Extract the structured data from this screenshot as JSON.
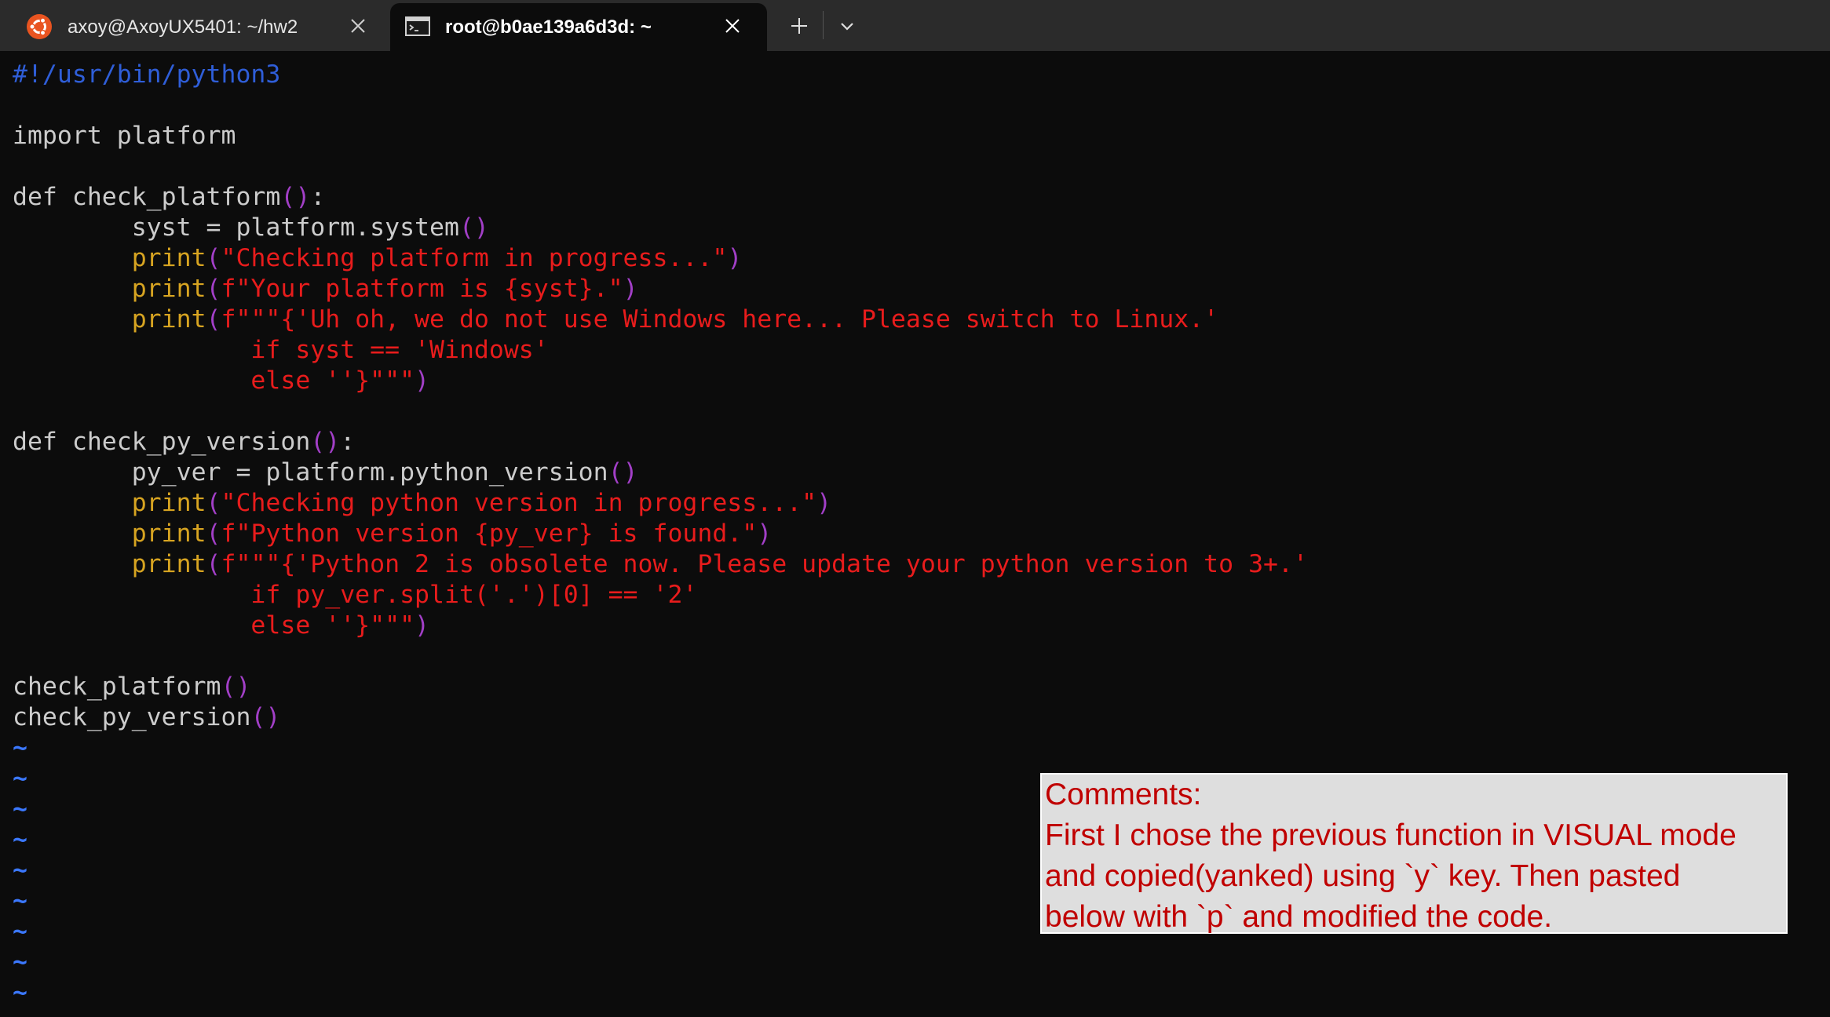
{
  "tabs": [
    {
      "title": "axoy@AxoyUX5401: ~/hw2",
      "icon": "ubuntu-icon",
      "active": false
    },
    {
      "title": "root@b0ae139a6d3d: ~",
      "icon": "terminal-icon",
      "active": true
    }
  ],
  "tabbar": {
    "new_tab_icon": "plus-icon",
    "dropdown_icon": "chevron-down-icon"
  },
  "colors": {
    "background": "#0c0c0c",
    "tabbar": "#2b2b2b",
    "shebang": "#2f5ed8",
    "string": "#e81c1c",
    "builtin": "#d7a421",
    "paren": "#a23fc7",
    "tilde": "#3b78ff",
    "comment_bg": "#dedede",
    "comment_text": "#c00000"
  },
  "code_lines": [
    [
      {
        "t": "#!/usr/bin/python3",
        "c": "shebang"
      }
    ],
    [],
    [
      {
        "t": "import platform",
        "c": "text"
      }
    ],
    [],
    [
      {
        "t": "def check_platform",
        "c": "text"
      },
      {
        "t": "()",
        "c": "paren"
      },
      {
        "t": ":",
        "c": "text"
      }
    ],
    [
      {
        "t": "        syst = platform.system",
        "c": "text"
      },
      {
        "t": "()",
        "c": "paren"
      }
    ],
    [
      {
        "t": "        ",
        "c": "text"
      },
      {
        "t": "print",
        "c": "fn"
      },
      {
        "t": "(",
        "c": "paren"
      },
      {
        "t": "\"Checking platform in progress...\"",
        "c": "str"
      },
      {
        "t": ")",
        "c": "paren"
      }
    ],
    [
      {
        "t": "        ",
        "c": "text"
      },
      {
        "t": "print",
        "c": "fn"
      },
      {
        "t": "(",
        "c": "paren"
      },
      {
        "t": "f\"Your platform is {syst}.\"",
        "c": "str"
      },
      {
        "t": ")",
        "c": "paren"
      }
    ],
    [
      {
        "t": "        ",
        "c": "text"
      },
      {
        "t": "print",
        "c": "fn"
      },
      {
        "t": "(",
        "c": "paren"
      },
      {
        "t": "f\"\"\"{'Uh oh, we do not use Windows here... Please switch to Linux.'",
        "c": "str"
      }
    ],
    [
      {
        "t": "                if syst == 'Windows'",
        "c": "str"
      }
    ],
    [
      {
        "t": "                else ''}\"\"\"",
        "c": "str"
      },
      {
        "t": ")",
        "c": "paren"
      }
    ],
    [],
    [
      {
        "t": "def check_py_version",
        "c": "text"
      },
      {
        "t": "()",
        "c": "paren"
      },
      {
        "t": ":",
        "c": "text"
      }
    ],
    [
      {
        "t": "        py_ver = platform.python_version",
        "c": "text"
      },
      {
        "t": "()",
        "c": "paren"
      }
    ],
    [
      {
        "t": "        ",
        "c": "text"
      },
      {
        "t": "print",
        "c": "fn"
      },
      {
        "t": "(",
        "c": "paren"
      },
      {
        "t": "\"Checking python version in progress...\"",
        "c": "str"
      },
      {
        "t": ")",
        "c": "paren"
      }
    ],
    [
      {
        "t": "        ",
        "c": "text"
      },
      {
        "t": "print",
        "c": "fn"
      },
      {
        "t": "(",
        "c": "paren"
      },
      {
        "t": "f\"Python version {py_ver} is found.\"",
        "c": "str"
      },
      {
        "t": ")",
        "c": "paren"
      }
    ],
    [
      {
        "t": "        ",
        "c": "text"
      },
      {
        "t": "print",
        "c": "fn"
      },
      {
        "t": "(",
        "c": "paren"
      },
      {
        "t": "f\"\"\"{'Python 2 is obsolete now. Please update your python version to 3+.'",
        "c": "str"
      }
    ],
    [
      {
        "t": "                if py_ver.split('.')[0] == '2'",
        "c": "str"
      }
    ],
    [
      {
        "t": "                else ''}\"\"\"",
        "c": "str"
      },
      {
        "t": ")",
        "c": "paren"
      }
    ],
    [],
    [
      {
        "t": "check_platform",
        "c": "text"
      },
      {
        "t": "()",
        "c": "paren"
      }
    ],
    [
      {
        "t": "check_py_version",
        "c": "text"
      },
      {
        "t": "()",
        "c": "paren"
      }
    ],
    [
      {
        "t": "~",
        "c": "tilde"
      }
    ],
    [
      {
        "t": "~",
        "c": "tilde"
      }
    ],
    [
      {
        "t": "~",
        "c": "tilde"
      }
    ],
    [
      {
        "t": "~",
        "c": "tilde"
      }
    ],
    [
      {
        "t": "~",
        "c": "tilde"
      }
    ],
    [
      {
        "t": "~",
        "c": "tilde"
      }
    ],
    [
      {
        "t": "~",
        "c": "tilde"
      }
    ],
    [
      {
        "t": "~",
        "c": "tilde"
      }
    ],
    [
      {
        "t": "~",
        "c": "tilde"
      }
    ]
  ],
  "comment": {
    "lines": [
      "Comments:",
      "First I chose the previous function in VISUAL mode",
      "and copied(yanked) using `y` key. Then pasted",
      "below with `p` and modified the code."
    ]
  }
}
